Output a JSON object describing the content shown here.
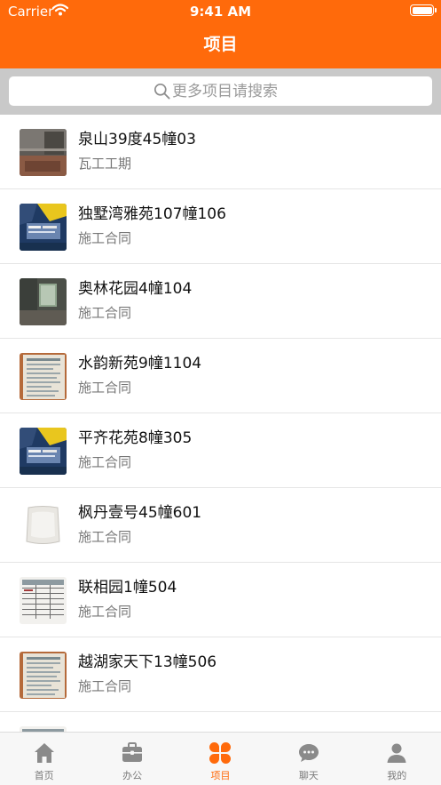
{
  "status_bar": {
    "carrier": "Carrier",
    "time": "9:41 AM"
  },
  "nav": {
    "title": "项目"
  },
  "search": {
    "placeholder": "更多项目请搜索"
  },
  "projects": [
    {
      "title": "泉山39度45幢03",
      "subtitle": "瓦工工期",
      "thumbnail": "bare-room-photo"
    },
    {
      "title": "独墅湾雅苑107幢106",
      "subtitle": "施工合同",
      "thumbnail": "worker-banner-photo"
    },
    {
      "title": "奥林花园4幢104",
      "subtitle": "施工合同",
      "thumbnail": "green-room-photo"
    },
    {
      "title": "水韵新苑9幢1104",
      "subtitle": "施工合同",
      "thumbnail": "contract-document-photo"
    },
    {
      "title": "平齐花苑8幢305",
      "subtitle": "施工合同",
      "thumbnail": "worker-banner-photo"
    },
    {
      "title": "枫丹壹号45幢601",
      "subtitle": "施工合同",
      "thumbnail": "white-paper-photo"
    },
    {
      "title": "联相园1幢504",
      "subtitle": "施工合同",
      "thumbnail": "document-table-photo"
    },
    {
      "title": "越湖家天下13幢506",
      "subtitle": "施工合同",
      "thumbnail": "contract-document-photo"
    },
    {
      "title": "",
      "subtitle": "",
      "thumbnail": "document-table-photo"
    }
  ],
  "tabbar": {
    "active": "项目",
    "tabs": [
      {
        "label": "首页",
        "icon": "home-icon"
      },
      {
        "label": "办公",
        "icon": "briefcase-icon"
      },
      {
        "label": "项目",
        "icon": "four-petal-icon"
      },
      {
        "label": "聊天",
        "icon": "chat-bubble-icon"
      },
      {
        "label": "我的",
        "icon": "person-icon"
      }
    ]
  },
  "colors": {
    "brand_orange": "#ff6a0b",
    "tab_inactive": "#8a8a8a",
    "search_band": "#c9c9c9"
  }
}
